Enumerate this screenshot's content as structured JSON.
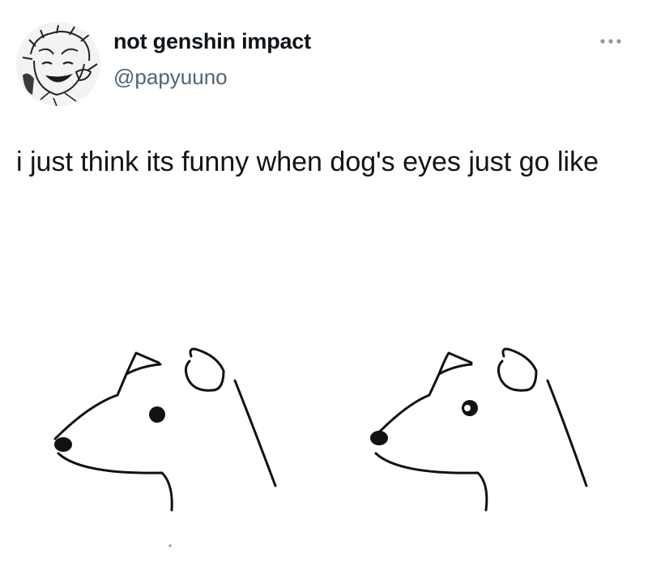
{
  "tweet": {
    "author": {
      "display_name": "not genshin impact",
      "handle": "@papyuuno",
      "avatar_icon": "avatar-drawing"
    },
    "more_icon": "more-options-icon",
    "text": "i just think its funny when dog's eyes just go like",
    "media": {
      "icon": "dog-eyes-drawing",
      "panels": [
        {
          "eye": "solid-dot"
        },
        {
          "eye": "dot-with-highlight"
        }
      ]
    }
  },
  "colors": {
    "text": "#0f1419",
    "secondary_text": "#536471",
    "background": "#ffffff",
    "drawing_stroke": "#111111"
  }
}
